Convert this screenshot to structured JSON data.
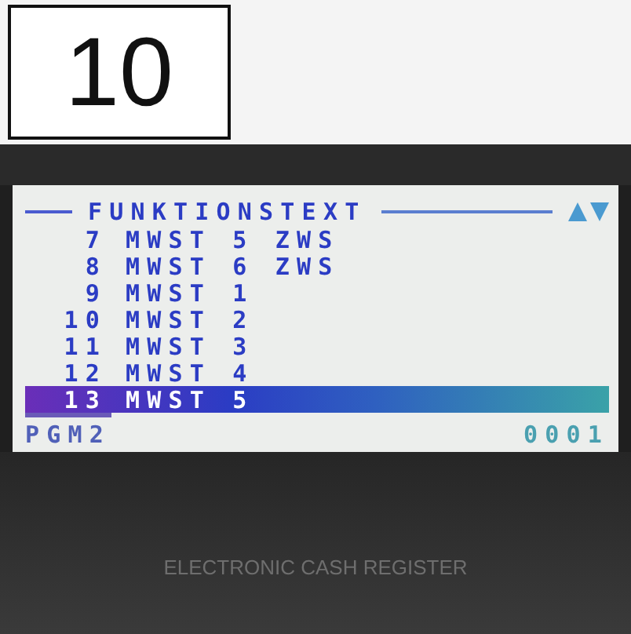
{
  "step_label": "10",
  "screen": {
    "title": "FUNKTIONSTEXT",
    "rows": [
      {
        "number": "7",
        "text": "MWST 5 ZWS",
        "selected": false
      },
      {
        "number": "8",
        "text": "MWST 6 ZWS",
        "selected": false
      },
      {
        "number": "9",
        "text": "MWST 1",
        "selected": false
      },
      {
        "number": "10",
        "text": "MWST 2",
        "selected": false
      },
      {
        "number": "11",
        "text": "MWST 3",
        "selected": false
      },
      {
        "number": "12",
        "text": "MWST 4",
        "selected": false
      },
      {
        "number": "13",
        "text": "MWST 5",
        "selected": true
      }
    ],
    "mode": "PGM2",
    "counter": "0001"
  },
  "device_label": "ELECTRONIC CASH REGISTER"
}
